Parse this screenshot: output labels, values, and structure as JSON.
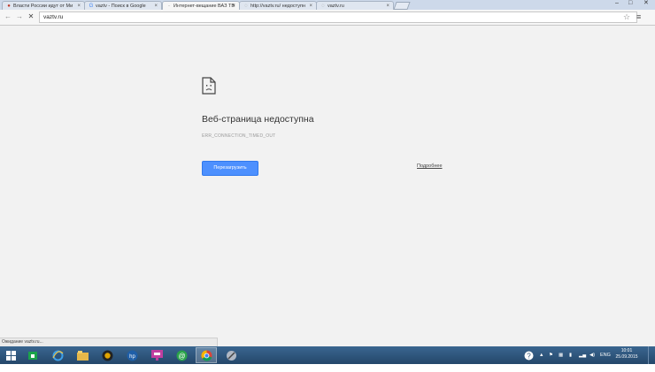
{
  "tabs": [
    {
      "label": "Власти России идут от Ми",
      "icon": "pin-icon",
      "active": false
    },
    {
      "label": "vaztv - Поиск в Google",
      "icon": "google-icon",
      "active": false
    },
    {
      "label": "Интернет-вещание ВАЗ ТВ",
      "icon": "dot-icon",
      "active": true
    },
    {
      "label": "http://vaztv.ru/ недоступн",
      "icon": "globe-icon",
      "active": false
    },
    {
      "label": "vaztv.ru",
      "icon": "globe-icon",
      "active": false
    }
  ],
  "window": {
    "minimize": "–",
    "maximize": "□",
    "close": "✕"
  },
  "toolbar": {
    "back": "←",
    "forward": "→",
    "stop": "✕",
    "url": "vaztv.ru",
    "star": "☆",
    "menu": "≡"
  },
  "error": {
    "title": "Веб-страница недоступна",
    "code": "ERR_CONNECTION_TIMED_OUT",
    "reload_label": "Перезагрузить",
    "details_label": "Подробнее"
  },
  "status": {
    "text": "Ожидание vaztv.ru..."
  },
  "taskbar": {
    "apps": [
      "start-icon",
      "store-icon",
      "ie-icon",
      "explorer-icon",
      "media-icon",
      "hp-icon",
      "app-icon",
      "mail-icon",
      "chrome-icon",
      "tool-icon"
    ],
    "lang": "ENG",
    "time": "10:01",
    "date": "25.09.2015"
  },
  "colors": {
    "accent": "#4d90fe",
    "taskbar": "#2b4f72"
  }
}
